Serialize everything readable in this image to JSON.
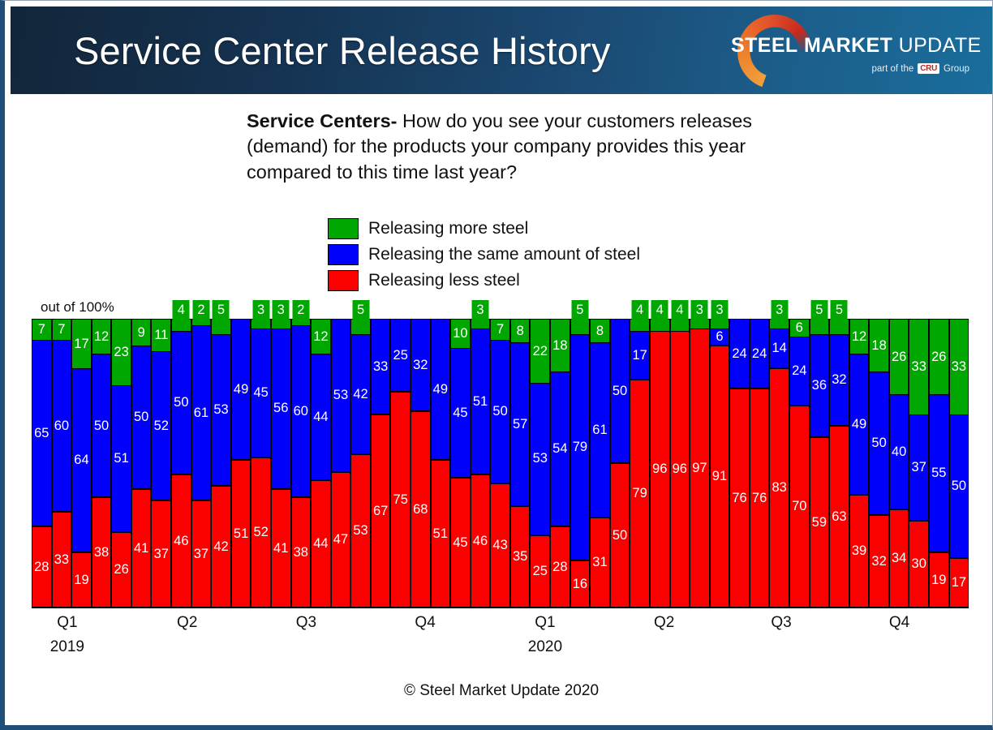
{
  "header": {
    "title": "Service Center Release History",
    "logo": {
      "word1": "STEEL",
      "word2": "MARKET",
      "word3": "UPDATE",
      "sub_prefix": "part of the",
      "sub_badge": "CRU",
      "sub_suffix": "Group"
    }
  },
  "question": {
    "lead": "Service Centers-",
    "body": "  How do you see your customers releases (demand) for the products your company provides this year compared to this time last year?"
  },
  "legend": [
    {
      "label": "Releasing more steel",
      "color": "#00a700"
    },
    {
      "label": "Releasing the same amount of steel",
      "color": "#0000fb"
    },
    {
      "label": "Releasing less steel",
      "color": "#fb0000"
    }
  ],
  "axis_note": "out of 100%",
  "footer": "© Steel Market Update 2020",
  "xaxis": {
    "quarters": [
      {
        "label": "Q1",
        "pos_pct": 3.8
      },
      {
        "label": "Q2",
        "pos_pct": 16.6
      },
      {
        "label": "Q3",
        "pos_pct": 29.3
      },
      {
        "label": "Q4",
        "pos_pct": 42.0
      },
      {
        "label": "Q1",
        "pos_pct": 54.8
      },
      {
        "label": "Q2",
        "pos_pct": 67.5
      },
      {
        "label": "Q3",
        "pos_pct": 80.0
      },
      {
        "label": "Q4",
        "pos_pct": 92.6
      }
    ],
    "years": [
      {
        "label": "2019",
        "pos_pct": 3.8
      },
      {
        "label": "2020",
        "pos_pct": 54.8
      }
    ]
  },
  "chart_data": {
    "type": "bar",
    "subtype": "stacked-100-percent",
    "title": "Service Center Release History",
    "subtitle": "Service Centers- How do you see your customers releases (demand) for the products your company provides this year compared to this time last year?",
    "xlabel": "",
    "ylabel": "out of 100%",
    "ylim": [
      0,
      100
    ],
    "grid": false,
    "legend_position": "above-plot-center",
    "categories": [
      "2019-Q1-a",
      "2019-Q1-b",
      "2019-Q1-c",
      "2019-Q1-d",
      "2019-Q1-e",
      "2019-Q1-f",
      "2019-Q2-a",
      "2019-Q2-b",
      "2019-Q2-c",
      "2019-Q2-d",
      "2019-Q2-e",
      "2019-Q2-f",
      "2019-Q3-a",
      "2019-Q3-b",
      "2019-Q3-c",
      "2019-Q3-d",
      "2019-Q3-e",
      "2019-Q3-f",
      "2019-Q4-a",
      "2019-Q4-b",
      "2019-Q4-c",
      "2019-Q4-d",
      "2019-Q4-e",
      "2020-Q1-a",
      "2020-Q1-b",
      "2020-Q1-c",
      "2020-Q1-d",
      "2020-Q1-e",
      "2020-Q1-f",
      "2020-Q2-a",
      "2020-Q2-b",
      "2020-Q2-c",
      "2020-Q2-d",
      "2020-Q2-e",
      "2020-Q2-f",
      "2020-Q3-a",
      "2020-Q3-b",
      "2020-Q3-c",
      "2020-Q3-d",
      "2020-Q3-e",
      "2020-Q3-f",
      "2020-Q4-a",
      "2020-Q4-b",
      "2020-Q4-c",
      "2020-Q4-d",
      "2020-Q4-e"
    ],
    "series": [
      {
        "name": "Releasing more steel",
        "color": "#00a700",
        "values": [
          7,
          7,
          17,
          12,
          23,
          9,
          11,
          4,
          2,
          5,
          0,
          0,
          3,
          3,
          2,
          12,
          0,
          5,
          0,
          0,
          0,
          0,
          10,
          3,
          7,
          8,
          22,
          18,
          5,
          8,
          0,
          4,
          4,
          4,
          3,
          3,
          6,
          5,
          5,
          12,
          18,
          26,
          33,
          26,
          33,
          0
        ]
      },
      {
        "name": "Releasing the same amount of steel",
        "color": "#0000fb",
        "values": [
          65,
          60,
          64,
          50,
          51,
          50,
          52,
          50,
          61,
          53,
          49,
          45,
          56,
          60,
          44,
          53,
          42,
          33,
          25,
          32,
          49,
          45,
          51,
          50,
          57,
          53,
          54,
          79,
          61,
          50,
          17,
          0,
          0,
          0,
          6,
          24,
          24,
          14,
          24,
          36,
          32,
          49,
          50,
          40,
          37,
          55
        ]
      },
      {
        "name": "Releasing less steel",
        "color": "#fb0000",
        "values": [
          28,
          33,
          19,
          38,
          26,
          41,
          37,
          46,
          37,
          42,
          51,
          52,
          41,
          38,
          44,
          47,
          53,
          67,
          75,
          68,
          51,
          45,
          46,
          43,
          35,
          25,
          28,
          16,
          31,
          50,
          79,
          96,
          96,
          97,
          91,
          76,
          76,
          83,
          70,
          59,
          63,
          39,
          32,
          34,
          30,
          19
        ]
      }
    ]
  },
  "bars": [
    {
      "green": 7,
      "blue": 65,
      "red": 28
    },
    {
      "green": 7,
      "blue": 60,
      "red": 33
    },
    {
      "green": 17,
      "blue": 64,
      "red": 19
    },
    {
      "green": 12,
      "blue": 50,
      "red": 38
    },
    {
      "green": 23,
      "blue": 51,
      "red": 26
    },
    {
      "green": 9,
      "blue": 50,
      "red": 41
    },
    {
      "green": 11,
      "blue": 52,
      "red": 37
    },
    {
      "green": 4,
      "blue": 50,
      "red": 46
    },
    {
      "green": 2,
      "blue": 61,
      "red": 37
    },
    {
      "green": 5,
      "blue": 53,
      "red": 42
    },
    {
      "green": 0,
      "blue": 49,
      "red": 51
    },
    {
      "green": 3,
      "blue": 45,
      "red": 52
    },
    {
      "green": 3,
      "blue": 56,
      "red": 41
    },
    {
      "green": 2,
      "blue": 60,
      "red": 38
    },
    {
      "green": 12,
      "blue": 44,
      "red": 44
    },
    {
      "green": 0,
      "blue": 53,
      "red": 47
    },
    {
      "green": 5,
      "blue": 42,
      "red": 53
    },
    {
      "green": 0,
      "blue": 33,
      "red": 67
    },
    {
      "green": 0,
      "blue": 25,
      "red": 75
    },
    {
      "green": 0,
      "blue": 32,
      "red": 68
    },
    {
      "green": 0,
      "blue": 49,
      "red": 51
    },
    {
      "green": 10,
      "blue": 45,
      "red": 45
    },
    {
      "green": 3,
      "blue": 51,
      "red": 46
    },
    {
      "green": 7,
      "blue": 50,
      "red": 43
    },
    {
      "green": 8,
      "blue": 57,
      "red": 35
    },
    {
      "green": 22,
      "blue": 53,
      "red": 25
    },
    {
      "green": 18,
      "blue": 54,
      "red": 28
    },
    {
      "green": 5,
      "blue": 79,
      "red": 16
    },
    {
      "green": 8,
      "blue": 61,
      "red": 31
    },
    {
      "green": 0,
      "blue": 50,
      "red": 50
    },
    {
      "green": 4,
      "blue": 17,
      "red": 79
    },
    {
      "green": 4,
      "blue": 0,
      "red": 96
    },
    {
      "green": 4,
      "blue": 0,
      "red": 96
    },
    {
      "green": 3,
      "blue": 0,
      "red": 97
    },
    {
      "green": 3,
      "blue": 6,
      "red": 91
    },
    {
      "green": 0,
      "blue": 24,
      "red": 76
    },
    {
      "green": 0,
      "blue": 24,
      "red": 76
    },
    {
      "green": 3,
      "blue": 14,
      "red": 83
    },
    {
      "green": 6,
      "blue": 24,
      "red": 70
    },
    {
      "green": 5,
      "blue": 36,
      "red": 59
    },
    {
      "green": 5,
      "blue": 32,
      "red": 63
    },
    {
      "green": 12,
      "blue": 49,
      "red": 39
    },
    {
      "green": 18,
      "blue": 50,
      "red": 32
    },
    {
      "green": 26,
      "blue": 40,
      "red": 34
    },
    {
      "green": 33,
      "blue": 37,
      "red": 30
    },
    {
      "green": 26,
      "blue": 55,
      "red": 19
    },
    {
      "green": 33,
      "blue": 50,
      "red": 17
    }
  ]
}
